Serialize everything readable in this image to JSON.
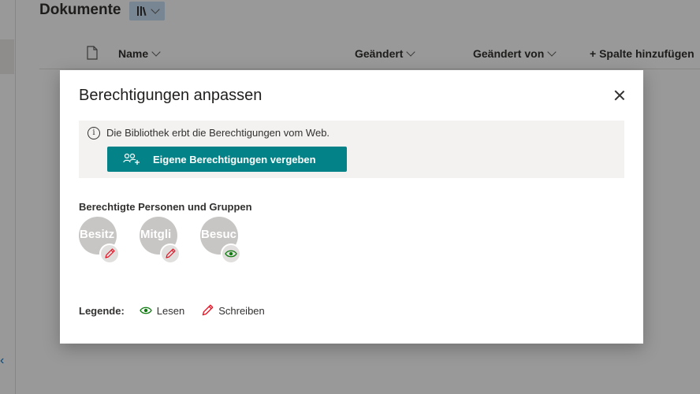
{
  "background": {
    "library_title": "Dokumente",
    "columns": {
      "name": "Name",
      "modified": "Geändert",
      "modified_by": "Geändert von",
      "add_column": "+ Spalte hinzufügen"
    }
  },
  "dialog": {
    "title": "Berechtigungen anpassen",
    "info_text": "Die Bibliothek erbt die Berechtigungen vom Web.",
    "primary_button": "Eigene Berechtigungen vergeben",
    "section_label": "Berechtigte Personen und Gruppen",
    "groups": [
      {
        "initials": "Besitz",
        "permission": "write"
      },
      {
        "initials": "Mitgli",
        "permission": "write"
      },
      {
        "initials": "Besuc",
        "permission": "read"
      }
    ],
    "legend": {
      "label": "Legende:",
      "read": "Lesen",
      "write": "Schreiben"
    }
  },
  "colors": {
    "accent": "#038387",
    "read_icon": "#107c10",
    "write_icon": "#e81123"
  }
}
